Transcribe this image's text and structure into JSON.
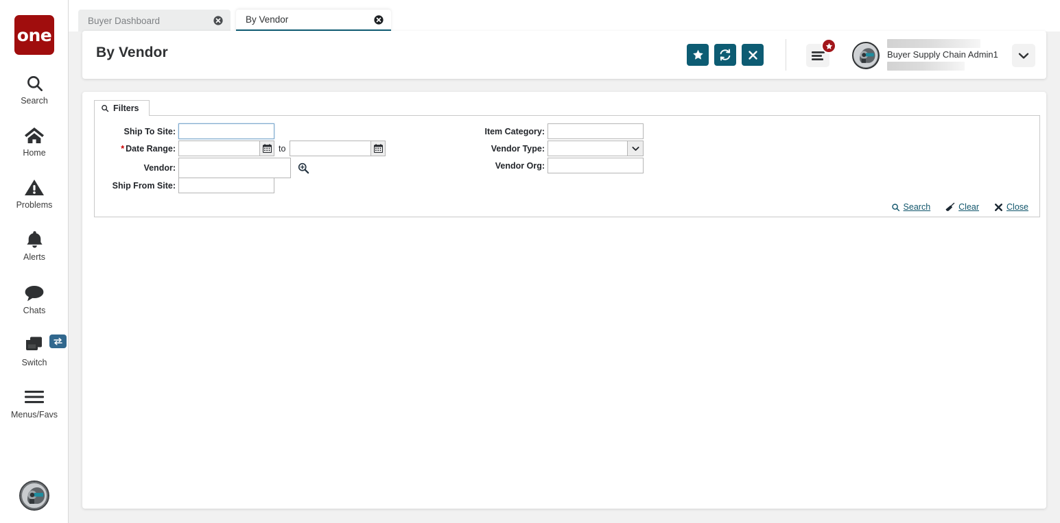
{
  "brand": {
    "logo_text": "one",
    "logo_color": "#a00d0d",
    "accent_color": "#0d5c73",
    "link_color": "#10556b",
    "badge_color": "#a2161b",
    "switch_badge_color": "#31688e"
  },
  "sidebar": {
    "items": [
      {
        "label": "Search",
        "icon": "search-icon"
      },
      {
        "label": "Home",
        "icon": "home-icon"
      },
      {
        "label": "Problems",
        "icon": "warning-triangle-icon"
      },
      {
        "label": "Alerts",
        "icon": "bell-icon"
      },
      {
        "label": "Chats",
        "icon": "chat-bubble-icon"
      },
      {
        "label": "Switch",
        "icon": "windows-stack-icon",
        "badge_icon": "swap-arrows-icon"
      },
      {
        "label": "Menus/Favs",
        "icon": "hamburger-icon"
      }
    ],
    "bottom_avatar_icon": "ai-head-avatar-icon"
  },
  "tabs": [
    {
      "label": "Buyer Dashboard",
      "active": false,
      "close_icon": "close-circle-icon"
    },
    {
      "label": "By Vendor",
      "active": true,
      "close_icon": "close-circle-icon"
    }
  ],
  "header": {
    "title": "By Vendor",
    "actions": [
      {
        "name": "favorite-button",
        "icon": "star-icon"
      },
      {
        "name": "refresh-button",
        "icon": "refresh-icon"
      },
      {
        "name": "close-button",
        "icon": "x-icon"
      }
    ],
    "menu_button_icon": "hamburger-icon",
    "menu_badge_icon": "star-icon",
    "user": {
      "name": "Buyer Supply Chain Admin1",
      "avatar_icon": "ai-head-avatar-icon",
      "caret_icon": "chevron-down-icon"
    }
  },
  "filters": {
    "tab_label": "Filters",
    "tab_icon": "search-icon",
    "fields_left": [
      {
        "label": "Ship To Site:",
        "required": false,
        "type": "text",
        "value": "",
        "placeholder": "",
        "focused": true,
        "name": "ship-to-site-field"
      },
      {
        "label": "Date Range:",
        "required": true,
        "type": "date-range",
        "value_from": "",
        "value_to": "",
        "separator": "to",
        "placeholder": "",
        "icon": "calendar-icon",
        "name": "date-range-field"
      },
      {
        "label": "Vendor:",
        "required": false,
        "type": "lookup",
        "value": "",
        "placeholder": "",
        "icon": "magnifier-plus-icon",
        "name": "vendor-field"
      },
      {
        "label": "Ship From Site:",
        "required": false,
        "type": "text",
        "value": "",
        "placeholder": "",
        "name": "ship-from-site-field"
      }
    ],
    "fields_right": [
      {
        "label": "Item Category:",
        "required": false,
        "type": "text",
        "value": "",
        "placeholder": "",
        "name": "item-category-field"
      },
      {
        "label": "Vendor Type:",
        "required": false,
        "type": "select",
        "value": "",
        "options": [
          ""
        ],
        "icon": "chevron-down-icon",
        "name": "vendor-type-select"
      },
      {
        "label": "Vendor Org:",
        "required": false,
        "type": "text",
        "value": "",
        "placeholder": "",
        "name": "vendor-org-field"
      }
    ],
    "actions": [
      {
        "label": "Search",
        "icon": "search-icon",
        "name": "search-link"
      },
      {
        "label": "Clear",
        "icon": "broom-icon",
        "name": "clear-link"
      },
      {
        "label": "Close",
        "icon": "x-icon",
        "name": "close-link"
      }
    ]
  }
}
